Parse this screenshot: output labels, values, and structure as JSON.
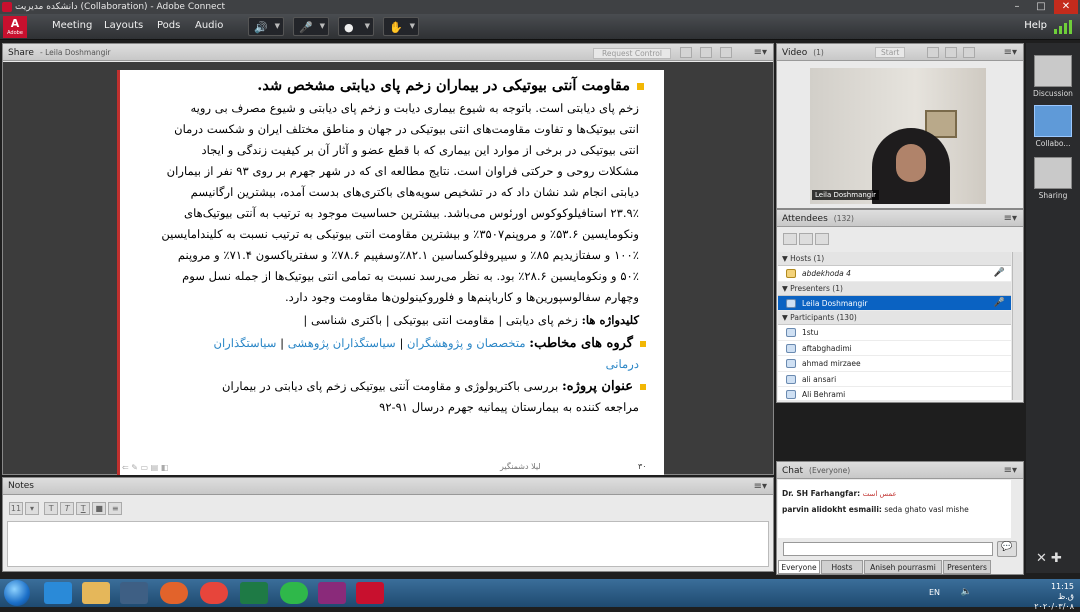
{
  "window": {
    "title": "دانشکده مدیریت (Collaboration) - Adobe Connect",
    "controls": [
      "–",
      "□",
      "✕"
    ]
  },
  "menubar": {
    "logo": "Adobe",
    "items": [
      "Meeting",
      "Layouts",
      "Pods",
      "Audio"
    ],
    "help": "Help"
  },
  "share_pod": {
    "title": "Share",
    "subtitle": "- Leila Doshmangir",
    "request_control": "Request Control",
    "menu": "≡▾"
  },
  "slide": {
    "heading": "مقاومت آنتی بیوتیکی در بیماران زخم پای دیابتی مشخص شد.",
    "paragraph": [
      "زخم پای دیابتی است. باتوجه به شیوع بیماری دیابت و زخم پای دیابتی و شیوع مصرف بی رویه",
      "انتی بیوتیک‌ها و تفاوت مقاومت‌های انتی بیوتیکی در جهان و مناطق مختلف ایران و شکست درمان",
      "انتی بیوتیکی در برخی از موارد این بیماری که با قطع عضو و آثار آن بر کیفیت زندگی و ایجاد",
      "مشکلات روحی و حرکتی فراوان است. نتایج مطالعه ای که در شهر جهرم بر روی ۹۳ نفر از بیماران",
      "دیابتی انجام شد نشان داد که در تشخیص سویه‌های باکتری‌های بدست آمده، بیشترین ارگانیسم",
      "۲۳.۹٪ استافیلوکوکوس اورئوس می‌باشد. بیشترین حساسیت موجود به ترتیب به آنتی بیوتیک‌های",
      "ونکومایسین ۵۳.۶٪ و مروپنم۳۵۰۷٪ و بیشترین مقاومت انتی بیوتیکی به ترتیب نسبت به کلیندامایسین",
      "۱۰۰٪ و سفتازیدیم ۸۵٪ و سیپروفلوکساسین ۸۲.۱٪وسفپیم ۷۸.۶٪ و سفتریاکسون ۷۱.۴٪ و مروپنم",
      "۵۰٪ و ونکومایسین ۲۸.۶٪ بود. به نظر می‌رسد نسبت به تمامی انتی بیوتیک‌ها از جمله نسل سوم",
      "وچهارم سفالوسپورین‌ها و کارباپنم‌ها و فلوروکینولون‌ها مقاومت وجود دارد."
    ],
    "keywords_label": "کلیدواژه ها:",
    "keywords_text": " زخم پای دیابتی | مقاومت انتی بیوتیکی | باکتری شناسی |",
    "audience_label": "گروه های مخاطب:",
    "audience_links": [
      "متخصصان و پژوهشگران",
      "سیاستگذاران پژوهشی",
      "سیاستگذاران"
    ],
    "audience_sep": " | ",
    "audience_line2": "درمانی",
    "project_label": "عنوان پروژه:",
    "project_line1": " بررسی باکتریولوژی و مقاومت آنتی بیوتیکی زخم پای دیابتی در بیماران",
    "project_line2": "مراجعه کننده به بیمارستان پیمانیه جهرم درسال ۹۱-۹۲",
    "footer": "لیلا دشمنگیر",
    "page_number": "۳۰"
  },
  "notes_pod": {
    "title": "Notes",
    "font_size": "11",
    "menu": "≡▾"
  },
  "video_pod": {
    "title": "Video",
    "count": "(1)",
    "start": "Start",
    "person": "Leila Doshmangir",
    "menu": "≡▾"
  },
  "attendees_pod": {
    "title": "Attendees",
    "count": "(132)",
    "menu": "≡▾",
    "hosts": {
      "label": "Hosts (1)",
      "items": [
        "abdekhoda 4"
      ]
    },
    "presenters": {
      "label": "Presenters (1)",
      "items": [
        "Leila Doshmangir"
      ]
    },
    "participants": {
      "label": "Participants (130)",
      "items": [
        "1stu",
        "aftabghadimi",
        "ahmad mirzaee",
        "ali ansari",
        "Ali Behrami"
      ]
    }
  },
  "chat_pod": {
    "title": "Chat",
    "scope": "(Everyone)",
    "menu": "≡▾",
    "messages": [
      {
        "sender": "Dr. SH Farhangfar:",
        "text": "عمس است"
      },
      {
        "sender": "parvin alidokht esmaili:",
        "text": "seda ghato vasl mishe"
      }
    ],
    "tabs": [
      "Everyone",
      "Hosts",
      "Aniseh pourrasmi",
      "Presenters"
    ]
  },
  "layouts_bar": {
    "items": [
      "Discussion",
      "Collabo...",
      "Sharing"
    ]
  },
  "taskbar": {
    "lang": "EN",
    "time": "11:15 ق.ظ",
    "date": "۲۰۲۰/۰۳/۰۸"
  },
  "colors": {
    "accent": "#2a86c6",
    "bullet": "#f2b705",
    "selection": "#0a62c2",
    "slide_edge": "#c0302e"
  }
}
